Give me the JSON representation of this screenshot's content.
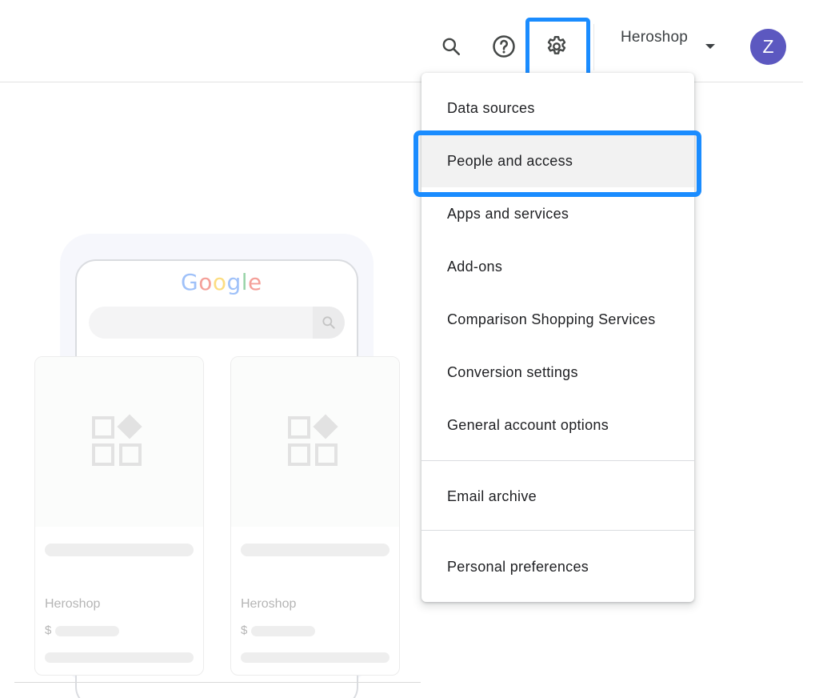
{
  "topbar": {
    "search_icon": "search-icon",
    "help_icon": "help-circle-icon",
    "settings_icon": "gear-icon",
    "account_name": "Heroshop",
    "avatar_letter": "Z",
    "avatar_color": "#5c58c0",
    "highlight_color": "#1a8cff"
  },
  "illustration": {
    "logo_text": "Google",
    "logo_colors": [
      "#4285f4",
      "#ea4335",
      "#fbbc05",
      "#4285f4",
      "#34a853",
      "#ea4335"
    ],
    "cards": [
      {
        "shop": "Heroshop",
        "currency": "$"
      },
      {
        "shop": "Heroshop",
        "currency": "$"
      }
    ]
  },
  "menu": {
    "items": [
      {
        "label": "Data sources"
      },
      {
        "label": "People and access",
        "highlighted": true
      },
      {
        "label": "Apps and services"
      },
      {
        "label": "Add-ons"
      },
      {
        "label": "Comparison Shopping Services"
      },
      {
        "label": "Conversion settings"
      },
      {
        "label": "General account options"
      },
      {
        "label": "Email archive"
      },
      {
        "label": "Personal preferences"
      }
    ]
  }
}
